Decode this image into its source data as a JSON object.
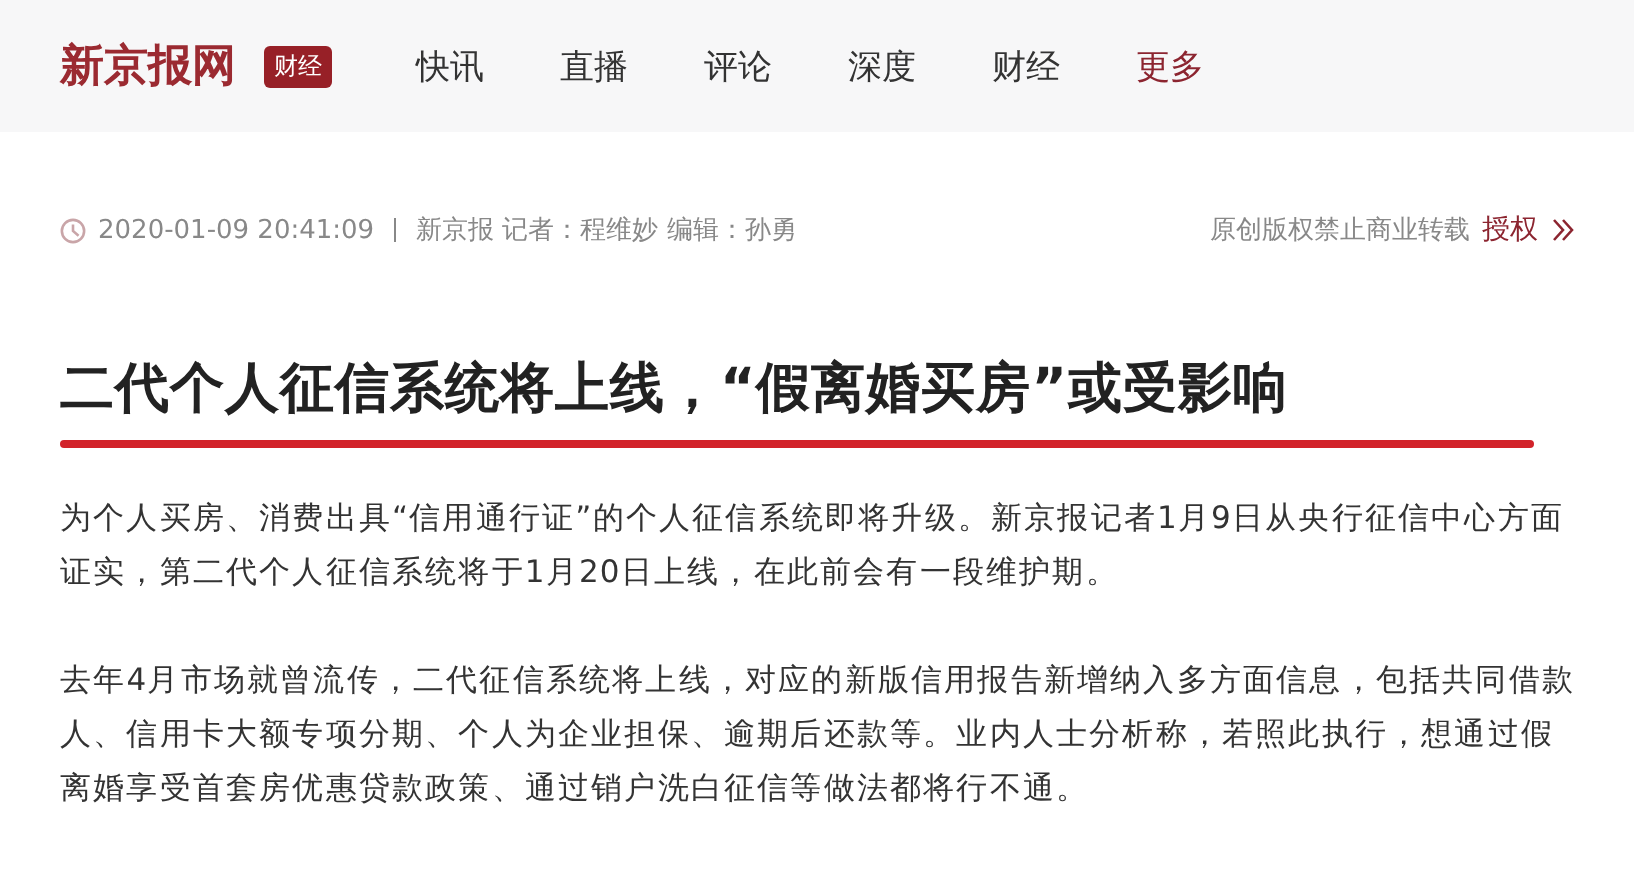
{
  "header": {
    "logo": "新京报网",
    "channel_badge": "财经",
    "nav": [
      {
        "label": "快讯",
        "selected": false
      },
      {
        "label": "直播",
        "selected": false
      },
      {
        "label": "评论",
        "selected": false
      },
      {
        "label": "深度",
        "selected": false
      },
      {
        "label": "财经",
        "selected": false
      },
      {
        "label": "更多",
        "selected": true
      }
    ]
  },
  "meta": {
    "time": "2020-01-09 20:41:09",
    "byline": "新京报 记者：程维妙 编辑：孙勇",
    "copyright": "原创版权禁止商业转载",
    "license_link": "授权"
  },
  "title": "二代个人征信系统将上线，“假离婚买房”或受影响",
  "paragraphs": [
    "为个人买房、消费出具“信用通行证”的个人征信系统即将升级。新京报记者1月9日从央行征信中心方面证实，第二代个人征信系统将于1月20日上线，在此前会有一段维护期。",
    "去年4月市场就曾流传，二代征信系统将上线，对应的新版信用报告新增纳入多方面信息，包括共同借款人、信用卡大额专项分期、个人为企业担保、逾期后还款等。业内人士分析称，若照此执行，想通过假离婚享受首套房优惠贷款政策、通过销户洗白征信等做法都将行不通。"
  ]
}
